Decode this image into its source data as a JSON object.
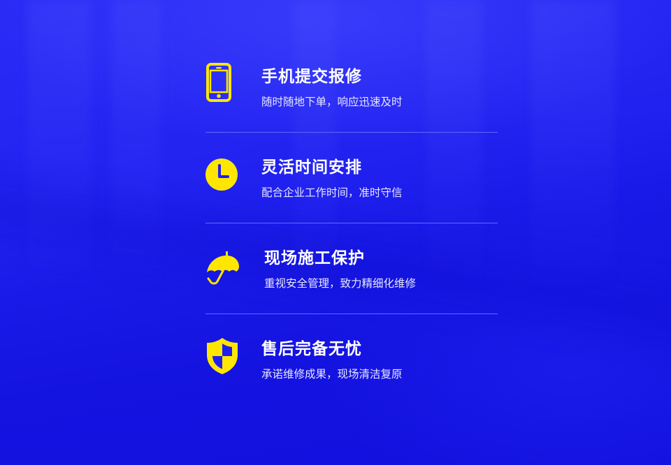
{
  "accent_color": "#ffe600",
  "features": [
    {
      "icon": "phone-icon",
      "title": "手机提交报修",
      "desc": "随时随地下单，响应迅速及时"
    },
    {
      "icon": "clock-icon",
      "title": "灵活时间安排",
      "desc": "配合企业工作时间，准时守信"
    },
    {
      "icon": "umbrella-icon",
      "title": "现场施工保护",
      "desc": "重视安全管理，致力精细化维修"
    },
    {
      "icon": "shield-icon",
      "title": "售后完备无忧",
      "desc": "承诺维修成果，现场清洁复原"
    }
  ]
}
